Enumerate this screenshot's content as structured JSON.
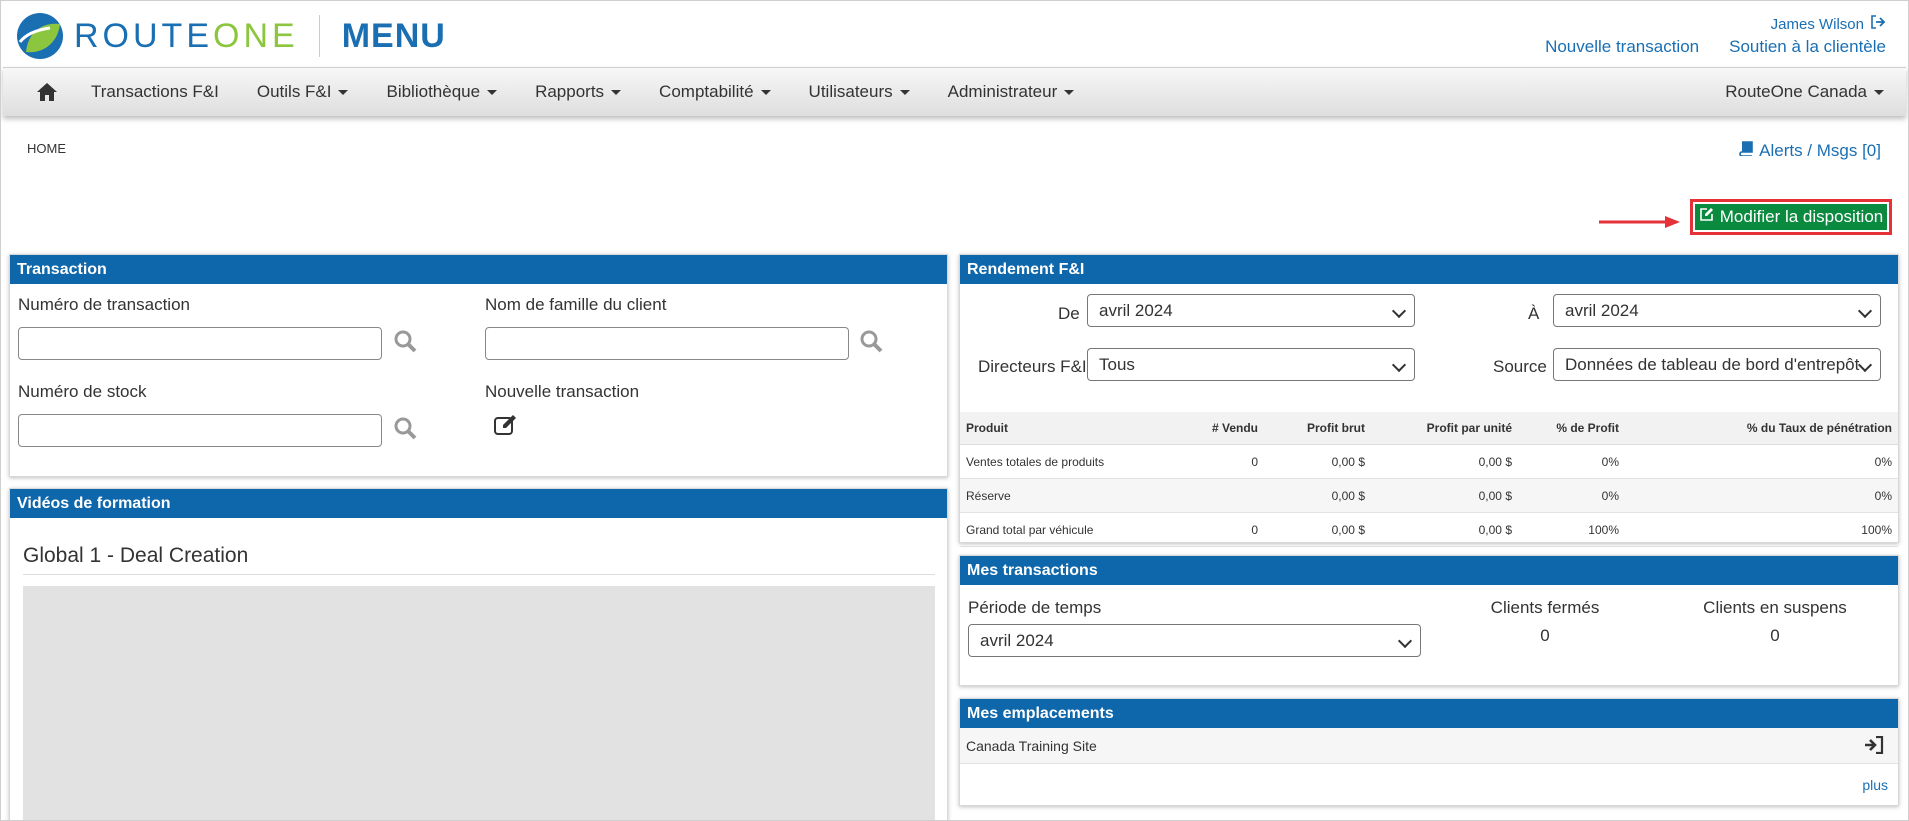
{
  "header": {
    "brand": "ROUTEONE",
    "brand_route": "ROUTE",
    "brand_one": "ONE",
    "menu": "MENU",
    "user": "James Wilson",
    "link_new_transaction": "Nouvelle transaction",
    "link_support": "Soutien à la clientèle"
  },
  "nav": {
    "items": [
      "Transactions F&I",
      "Outils F&I",
      "Bibliothèque",
      "Rapports",
      "Comptabilité",
      "Utilisateurs",
      "Administrateur"
    ],
    "right": "RouteOne Canada"
  },
  "breadcrumb": "HOME",
  "alerts": "Alerts / Msgs [0]",
  "modify_button": "Modifier la disposition",
  "transaction": {
    "title": "Transaction",
    "deal_number_label": "Numéro de transaction",
    "customer_lastname_label": "Nom de famille du client",
    "stock_number_label": "Numéro de stock",
    "new_deal_label": "Nouvelle transaction"
  },
  "videos": {
    "title": "Vidéos de formation",
    "video_title": "Global 1 - Deal Creation"
  },
  "perf": {
    "title": "Rendement F&I",
    "from_label": "De",
    "from_value": "avril 2024",
    "to_label": "À",
    "to_value": "avril 2024",
    "managers_label": "Directeurs F&I",
    "managers_value": "Tous",
    "source_label": "Source",
    "source_value": "Données de tableau de bord d'entrepôt",
    "columns": [
      "Produit",
      "# Vendu",
      "Profit brut",
      "Profit par unité",
      "% de Profit",
      "% du Taux de pénétration"
    ],
    "rows": [
      [
        "Ventes totales de produits",
        "0",
        "0,00 $",
        "0,00 $",
        "0%",
        "0%"
      ],
      [
        "Réserve",
        "",
        "0,00 $",
        "0,00 $",
        "0%",
        "0%"
      ],
      [
        "Grand total par véhicule",
        "0",
        "0,00 $",
        "0,00 $",
        "100%",
        "100%"
      ]
    ]
  },
  "deals": {
    "title": "Mes transactions",
    "period_label": "Période de temps",
    "period_value": "avril 2024",
    "closed_label": "Clients fermés",
    "closed_value": "0",
    "pending_label": "Clients en suspens",
    "pending_value": "0"
  },
  "locations": {
    "title": "Mes emplacements",
    "site": "Canada Training Site",
    "more": "plus"
  },
  "colors": {
    "brand_blue": "#1a6fb3",
    "brand_green": "#8cc63f",
    "panel_header": "#0f67ab",
    "button_green": "#0a8a3f",
    "highlight_red": "#e53238"
  }
}
